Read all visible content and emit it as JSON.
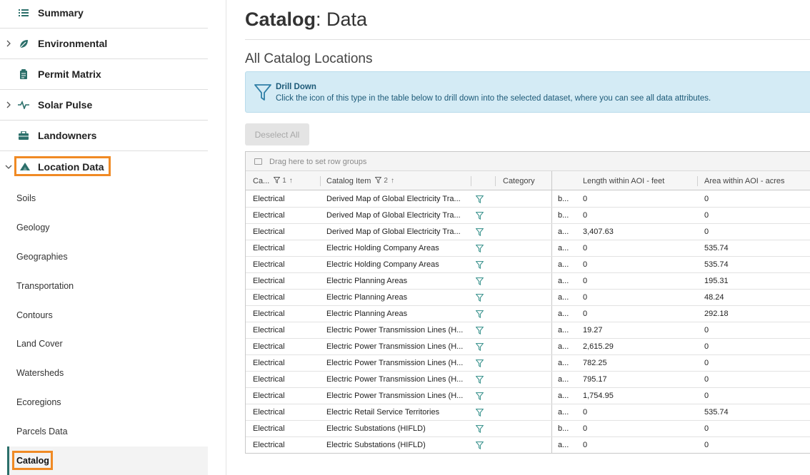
{
  "sidebar": {
    "top_items": [
      {
        "label": "Summary",
        "icon": "list-icon",
        "has_chevron": false
      },
      {
        "label": "Environmental",
        "icon": "leaf-icon",
        "has_chevron": true
      },
      {
        "label": "Permit Matrix",
        "icon": "clipboard-icon",
        "has_chevron": false
      },
      {
        "label": "Solar Pulse",
        "icon": "pulse-icon",
        "has_chevron": true
      },
      {
        "label": "Landowners",
        "icon": "briefcase-icon",
        "has_chevron": false
      },
      {
        "label": "Location Data",
        "icon": "mountain-icon",
        "has_chevron": true,
        "expanded": true
      }
    ],
    "sub_items": [
      "Soils",
      "Geology",
      "Geographies",
      "Transportation",
      "Contours",
      "Land Cover",
      "Watersheds",
      "Ecoregions",
      "Parcels Data",
      "Catalog"
    ],
    "active_sub_item": "Catalog"
  },
  "main": {
    "title_bold": "Catalog",
    "title_rest": ": Data",
    "section_title": "All Catalog Locations",
    "info": {
      "title": "Drill Down",
      "text": "Click the icon of this type in the table below to drill down into the selected dataset, where you can see all data attributes."
    },
    "deselect_label": "Deselect All",
    "grid": {
      "group_placeholder": "Drag here to set row groups",
      "headers": {
        "cat": "Ca...",
        "cat_sort": "1",
        "item": "Catalog Item",
        "item_sort": "2",
        "category": "Category",
        "length": "Length within AOI - feet",
        "area": "Area within AOI - acres"
      },
      "rows": [
        {
          "cat": "Electrical",
          "item": "Derived Map of Global Electricity Tra...",
          "short": "b...",
          "length": "0",
          "area": "0"
        },
        {
          "cat": "Electrical",
          "item": "Derived Map of Global Electricity Tra...",
          "short": "b...",
          "length": "0",
          "area": "0"
        },
        {
          "cat": "Electrical",
          "item": "Derived Map of Global Electricity Tra...",
          "short": "a...",
          "length": "3,407.63",
          "area": "0"
        },
        {
          "cat": "Electrical",
          "item": "Electric Holding Company Areas",
          "short": "a...",
          "length": "0",
          "area": "535.74"
        },
        {
          "cat": "Electrical",
          "item": "Electric Holding Company Areas",
          "short": "a...",
          "length": "0",
          "area": "535.74"
        },
        {
          "cat": "Electrical",
          "item": "Electric Planning Areas",
          "short": "a...",
          "length": "0",
          "area": "195.31"
        },
        {
          "cat": "Electrical",
          "item": "Electric Planning Areas",
          "short": "a...",
          "length": "0",
          "area": "48.24"
        },
        {
          "cat": "Electrical",
          "item": "Electric Planning Areas",
          "short": "a...",
          "length": "0",
          "area": "292.18"
        },
        {
          "cat": "Electrical",
          "item": "Electric Power Transmission Lines (H...",
          "short": "a...",
          "length": "19.27",
          "area": "0"
        },
        {
          "cat": "Electrical",
          "item": "Electric Power Transmission Lines (H...",
          "short": "a...",
          "length": "2,615.29",
          "area": "0"
        },
        {
          "cat": "Electrical",
          "item": "Electric Power Transmission Lines (H...",
          "short": "a...",
          "length": "782.25",
          "area": "0"
        },
        {
          "cat": "Electrical",
          "item": "Electric Power Transmission Lines (H...",
          "short": "a...",
          "length": "795.17",
          "area": "0"
        },
        {
          "cat": "Electrical",
          "item": "Electric Power Transmission Lines (H...",
          "short": "a...",
          "length": "1,754.95",
          "area": "0"
        },
        {
          "cat": "Electrical",
          "item": "Electric Retail Service Territories",
          "short": "a...",
          "length": "0",
          "area": "535.74"
        },
        {
          "cat": "Electrical",
          "item": "Electric Substations (HIFLD)",
          "short": "b...",
          "length": "0",
          "area": "0"
        },
        {
          "cat": "Electrical",
          "item": "Electric Substations (HIFLD)",
          "short": "a...",
          "length": "0",
          "area": "0"
        }
      ]
    }
  },
  "colors": {
    "accent_teal": "#2b6f6a",
    "highlight_orange": "#f08a24",
    "info_bg": "#d4ebf5",
    "info_text": "#1d5a78"
  }
}
